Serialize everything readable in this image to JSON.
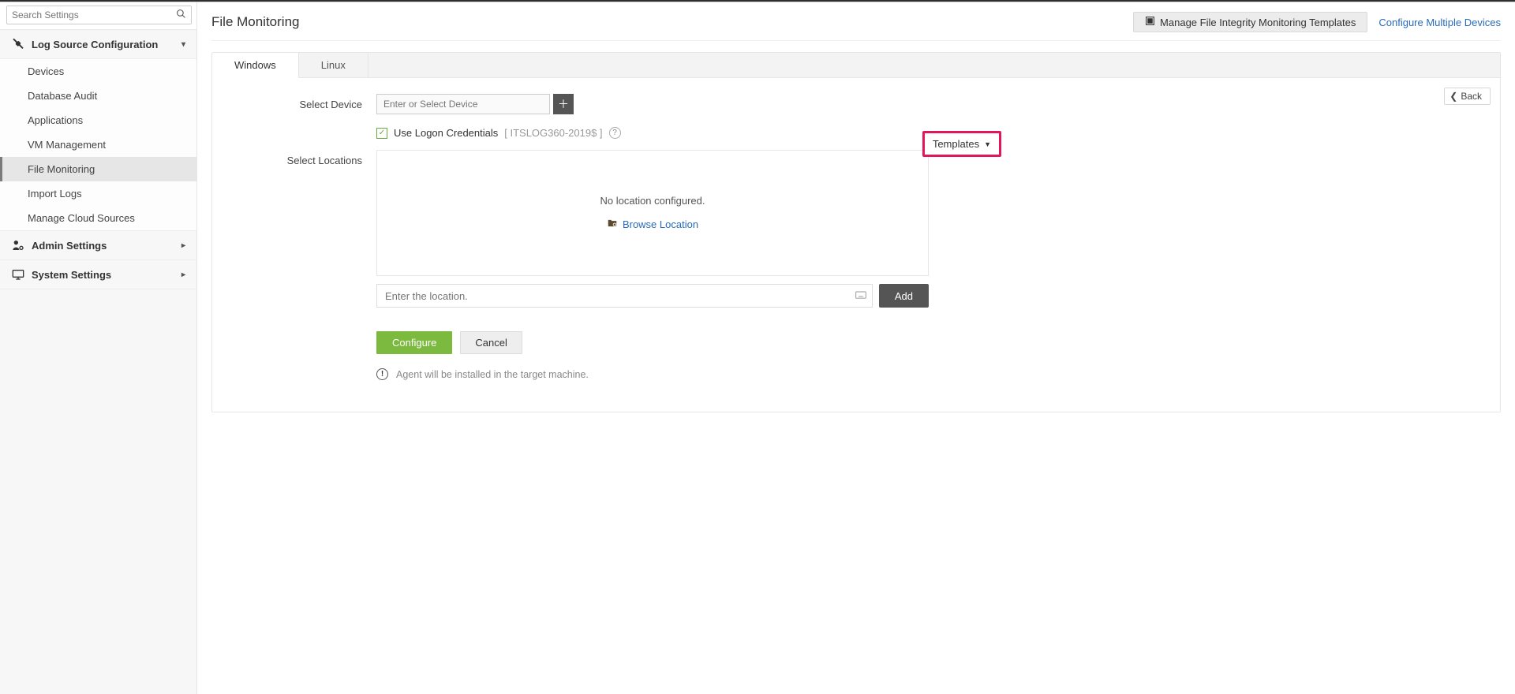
{
  "sidebar": {
    "search_placeholder": "Search Settings",
    "sections": [
      {
        "label": "Log Source Configuration",
        "expanded": true,
        "items": [
          {
            "label": "Devices"
          },
          {
            "label": "Database Audit"
          },
          {
            "label": "Applications"
          },
          {
            "label": "VM Management"
          },
          {
            "label": "File Monitoring",
            "active": true
          },
          {
            "label": "Import Logs"
          },
          {
            "label": "Manage Cloud Sources"
          }
        ]
      },
      {
        "label": "Admin Settings",
        "expanded": false
      },
      {
        "label": "System Settings",
        "expanded": false
      }
    ]
  },
  "page": {
    "title": "File Monitoring",
    "manage_templates_btn": "Manage File Integrity Monitoring Templates",
    "configure_multiple_link": "Configure Multiple Devices",
    "back_label": "Back"
  },
  "tabs": [
    {
      "label": "Windows",
      "active": true
    },
    {
      "label": "Linux",
      "active": false
    }
  ],
  "form": {
    "select_device_label": "Select Device",
    "select_device_placeholder": "Enter or Select Device",
    "use_creds_label": "Use Logon Credentials",
    "creds_host": "[ ITSLOG360-2019$ ]",
    "select_locations_label": "Select Locations",
    "no_location_text": "No location configured.",
    "browse_location_label": "Browse Location",
    "location_input_placeholder": "Enter the location.",
    "add_btn": "Add",
    "templates_label": "Templates",
    "configure_btn": "Configure",
    "cancel_btn": "Cancel",
    "agent_note": "Agent will be installed in the target machine."
  },
  "colors": {
    "accent_green": "#7bb93f",
    "link_blue": "#2a6bb8",
    "highlight_pink": "#e2175b"
  }
}
